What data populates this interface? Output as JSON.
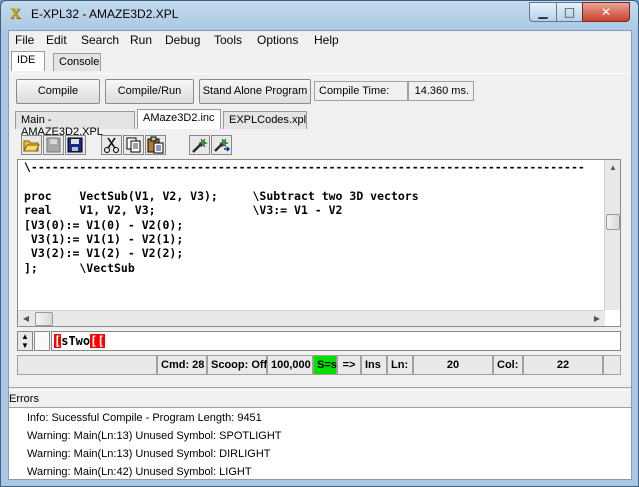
{
  "window": {
    "title": "E-XPL32 - AMAZE3D2.XPL",
    "icon": "x-logo-icon",
    "controls": {
      "minimize": "▁",
      "maximize": "□",
      "close": "✕"
    }
  },
  "menu": [
    "File",
    "Edit",
    "Search",
    "Run",
    "Debug",
    "Tools",
    "Options",
    "Help"
  ],
  "top_tabs": [
    {
      "label": "IDE",
      "active": true
    },
    {
      "label": "Console",
      "active": false
    }
  ],
  "toolbar": {
    "compile": "Compile",
    "compile_run": "Compile/Run",
    "stand_alone": "Stand Alone Program",
    "compile_time_label": "Compile Time:",
    "compile_time_value": "14.360 ms."
  },
  "file_tabs": [
    {
      "label": "Main - AMAZE3D2.XPL",
      "active": false
    },
    {
      "label": "AMaze3D2.inc",
      "active": true
    },
    {
      "label": "EXPLCodes.xpl",
      "active": false
    }
  ],
  "editor": {
    "lines": [
      "\\--------------------------------------------------------------------------------",
      "",
      "proc    VectSub(V1, V2, V3);     \\Subtract two 3D vectors",
      "real    V1, V2, V3;              \\V3:= V1 - V2",
      "[V3(0):= V1(0) - V2(0);",
      " V3(1):= V1(1) - V2(1);",
      " V3(2):= V1(2) - V2(2);",
      "];      \\VectSub"
    ]
  },
  "command": {
    "value_prefix": "[",
    "value_main": "sTwo",
    "value_suffix": "[["
  },
  "status": {
    "cmd": "Cmd: 28",
    "scoop": "Scoop: Off",
    "count": "100,000",
    "s_equals": "S=s",
    "arrow": "=>",
    "ins": "Ins",
    "ln_label": "Ln:",
    "ln_value": "20",
    "col_label": "Col:",
    "col_value": "22"
  },
  "errors": {
    "label": "Errors",
    "lines": [
      "Info: Sucessful Compile - Program Length:  9451",
      "Warning: Main(Ln:13) Unused Symbol: SPOTLIGHT",
      "Warning: Main(Ln:13) Unused Symbol: DIRLIGHT",
      "Warning: Main(Ln:42) Unused Symbol: LIGHT"
    ]
  },
  "colors": {
    "highlight_red": "#ff0000",
    "s_equals_green": "#00e000"
  }
}
